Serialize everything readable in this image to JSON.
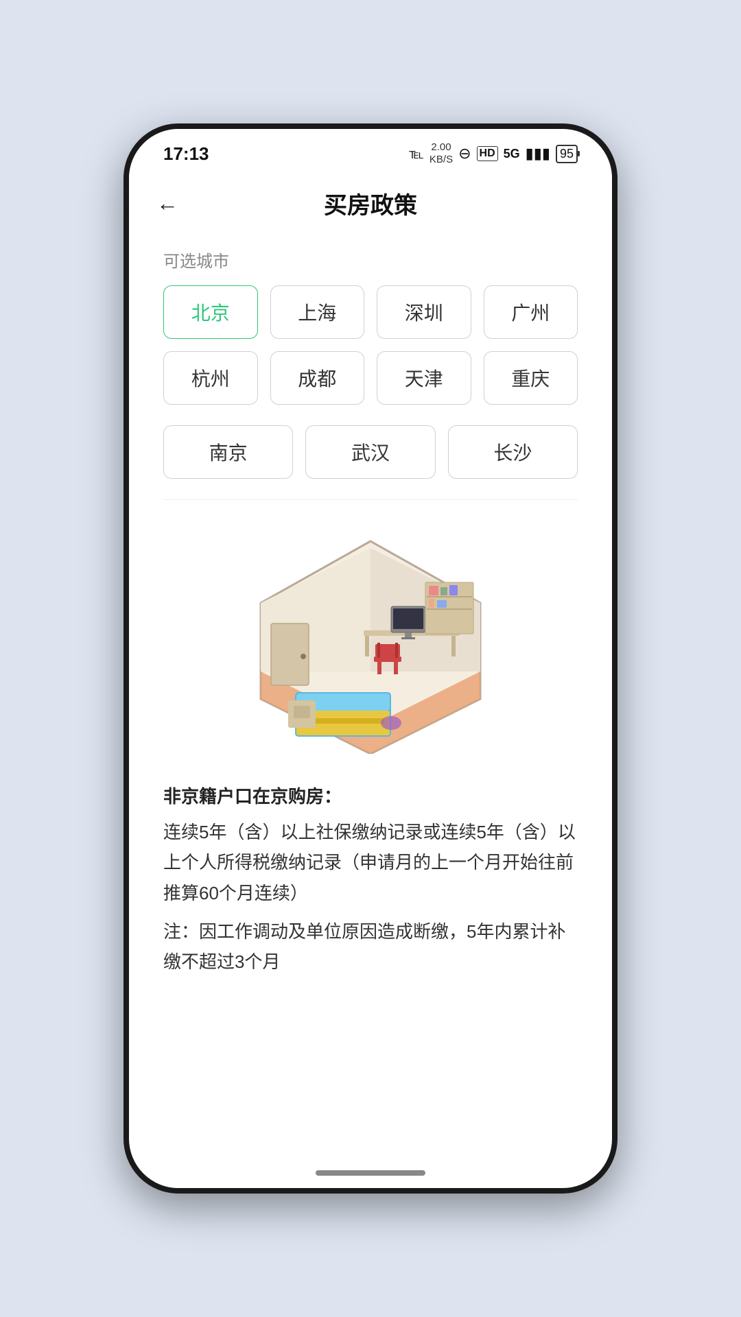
{
  "statusBar": {
    "time": "17:13",
    "kb": "2.00\nKB/S",
    "battery": "95"
  },
  "header": {
    "title": "买房政策",
    "backLabel": "←"
  },
  "citySection": {
    "label": "可选城市",
    "cities": [
      {
        "name": "北京",
        "active": true
      },
      {
        "name": "上海",
        "active": false
      },
      {
        "name": "深圳",
        "active": false
      },
      {
        "name": "广州",
        "active": false
      },
      {
        "name": "杭州",
        "active": false
      },
      {
        "name": "成都",
        "active": false
      },
      {
        "name": "天津",
        "active": false
      },
      {
        "name": "重庆",
        "active": false
      },
      {
        "name": "南京",
        "active": false
      },
      {
        "name": "武汉",
        "active": false
      },
      {
        "name": "长沙",
        "active": false
      }
    ]
  },
  "policyText": {
    "title": "非京籍户口在京购房：",
    "body": "连续5年（含）以上社保缴纳记录或连续5年（含）以上个人所得税缴纳记录（申请月的上一个月开始往前推算60个月连续）\n注：因工作调动及单位原因造成断缴，5年内累计补缴不超过3个月"
  },
  "colors": {
    "accent": "#2cc77a",
    "border": "#d0d0d0",
    "textPrimary": "#222",
    "textSecondary": "#888"
  }
}
